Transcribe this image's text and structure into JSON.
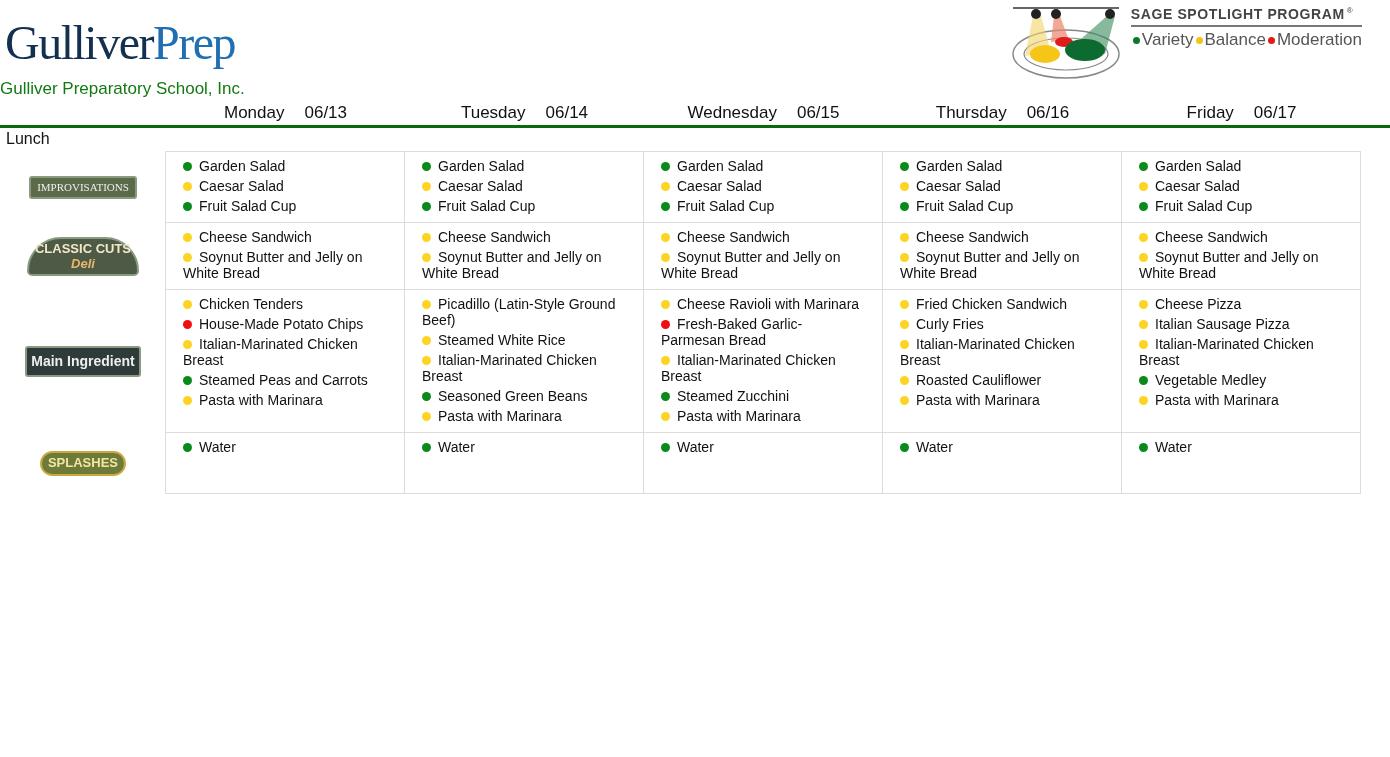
{
  "school": {
    "logo_parts": [
      "Gulliver",
      "Prep"
    ],
    "name": "Gulliver Preparatory School, Inc."
  },
  "program": {
    "title": "SAGE SPOTLIGHT PROGRAM",
    "mark": "®",
    "legend": [
      {
        "label": "Variety",
        "color": "#0a7a2a"
      },
      {
        "label": "Balance",
        "color": "#f2c418"
      },
      {
        "label": "Moderation",
        "color": "#e01b1b"
      }
    ]
  },
  "meal": "Lunch",
  "days": [
    {
      "day": "Monday",
      "date": "06/13"
    },
    {
      "day": "Tuesday",
      "date": "06/14"
    },
    {
      "day": "Wednesday",
      "date": "06/15"
    },
    {
      "day": "Thursday",
      "date": "06/16"
    },
    {
      "day": "Friday",
      "date": "06/17"
    }
  ],
  "stations": [
    {
      "kind": "garden",
      "logo": [
        "IMPROVISATIONS"
      ],
      "cells": [
        [
          {
            "name": "Garden Salad",
            "color": "#0a8a1a"
          },
          {
            "name": "Caesar Salad",
            "color": "#fdd324"
          },
          {
            "name": "Fruit Salad Cup",
            "color": "#0a8a1a"
          }
        ],
        [
          {
            "name": "Garden Salad",
            "color": "#0a8a1a"
          },
          {
            "name": "Caesar Salad",
            "color": "#fdd324"
          },
          {
            "name": "Fruit Salad Cup",
            "color": "#0a8a1a"
          }
        ],
        [
          {
            "name": "Garden Salad",
            "color": "#0a8a1a"
          },
          {
            "name": "Caesar Salad",
            "color": "#fdd324"
          },
          {
            "name": "Fruit Salad Cup",
            "color": "#0a8a1a"
          }
        ],
        [
          {
            "name": "Garden Salad",
            "color": "#0a8a1a"
          },
          {
            "name": "Caesar Salad",
            "color": "#fdd324"
          },
          {
            "name": "Fruit Salad Cup",
            "color": "#0a8a1a"
          }
        ],
        [
          {
            "name": "Garden Salad",
            "color": "#0a8a1a"
          },
          {
            "name": "Caesar Salad",
            "color": "#fdd324"
          },
          {
            "name": "Fruit Salad Cup",
            "color": "#0a8a1a"
          }
        ]
      ]
    },
    {
      "kind": "deli",
      "logo": [
        "CLASSIC CUTS",
        "Deli"
      ],
      "cells": [
        [
          {
            "name": "Cheese Sandwich",
            "color": "#fdd324"
          },
          {
            "name": "Soynut Butter and Jelly on White Bread",
            "color": "#fdd324"
          }
        ],
        [
          {
            "name": "Cheese Sandwich",
            "color": "#fdd324"
          },
          {
            "name": "Soynut Butter and Jelly on White Bread",
            "color": "#fdd324"
          }
        ],
        [
          {
            "name": "Cheese Sandwich",
            "color": "#fdd324"
          },
          {
            "name": "Soynut Butter and Jelly on White Bread",
            "color": "#fdd324"
          }
        ],
        [
          {
            "name": "Cheese Sandwich",
            "color": "#fdd324"
          },
          {
            "name": "Soynut Butter and Jelly on White Bread",
            "color": "#fdd324"
          }
        ],
        [
          {
            "name": "Cheese Sandwich",
            "color": "#fdd324"
          },
          {
            "name": "Soynut Butter and Jelly on White Bread",
            "color": "#fdd324"
          }
        ]
      ]
    },
    {
      "kind": "main",
      "logo": [
        "Main Ingredient"
      ],
      "cells": [
        [
          {
            "name": "Chicken Tenders",
            "color": "#fdd324"
          },
          {
            "name": "House-Made Potato Chips",
            "color": "#f00f0f"
          },
          {
            "name": "Italian-Marinated Chicken Breast",
            "color": "#fdd324"
          },
          {
            "name": "Steamed Peas and Carrots",
            "color": "#0a8a1a"
          },
          {
            "name": "Pasta with Marinara",
            "color": "#fdd324"
          }
        ],
        [
          {
            "name": "Picadillo (Latin-Style Ground Beef)",
            "color": "#fdd324"
          },
          {
            "name": "Steamed White Rice",
            "color": "#fdd324"
          },
          {
            "name": "Italian-Marinated Chicken Breast",
            "color": "#fdd324"
          },
          {
            "name": "Seasoned Green Beans",
            "color": "#0a8a1a"
          },
          {
            "name": "Pasta with Marinara",
            "color": "#fdd324"
          }
        ],
        [
          {
            "name": "Cheese Ravioli with Marinara",
            "color": "#fdd324"
          },
          {
            "name": "Fresh-Baked Garlic-Parmesan Bread",
            "color": "#f00f0f"
          },
          {
            "name": "Italian-Marinated Chicken Breast",
            "color": "#fdd324"
          },
          {
            "name": "Steamed Zucchini",
            "color": "#0a8a1a"
          },
          {
            "name": "Pasta with Marinara",
            "color": "#fdd324"
          }
        ],
        [
          {
            "name": "Fried Chicken Sandwich",
            "color": "#fdd324"
          },
          {
            "name": "Curly Fries",
            "color": "#fdd324"
          },
          {
            "name": "Italian-Marinated Chicken Breast",
            "color": "#fdd324"
          },
          {
            "name": "Roasted Cauliflower",
            "color": "#fdd324"
          },
          {
            "name": "Pasta with Marinara",
            "color": "#fdd324"
          }
        ],
        [
          {
            "name": "Cheese Pizza",
            "color": "#fdd324"
          },
          {
            "name": "Italian Sausage Pizza",
            "color": "#fdd324"
          },
          {
            "name": "Italian-Marinated Chicken Breast",
            "color": "#fdd324"
          },
          {
            "name": "Vegetable Medley",
            "color": "#0a8a1a"
          },
          {
            "name": "Pasta with Marinara",
            "color": "#fdd324"
          }
        ]
      ]
    },
    {
      "kind": "drinks",
      "logo": [
        "SPLASHES"
      ],
      "cells": [
        [
          {
            "name": "Water",
            "color": "#0a8a1a"
          }
        ],
        [
          {
            "name": "Water",
            "color": "#0a8a1a"
          }
        ],
        [
          {
            "name": "Water",
            "color": "#0a8a1a"
          }
        ],
        [
          {
            "name": "Water",
            "color": "#0a8a1a"
          }
        ],
        [
          {
            "name": "Water",
            "color": "#0a8a1a"
          }
        ]
      ]
    }
  ]
}
